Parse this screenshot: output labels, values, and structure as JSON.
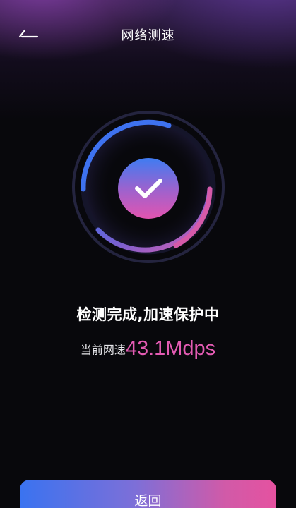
{
  "header": {
    "title": "网络测速",
    "back_icon": "back-arrow-icon"
  },
  "gauge": {
    "progress": 1,
    "status_icon": "check-icon",
    "colors": {
      "ring_start": "#3e72f0",
      "ring_end": "#e060b0",
      "badge_start": "#3f7cf2",
      "badge_end": "#e354b0"
    }
  },
  "result": {
    "status": "检测完成,加速保护中",
    "speed_label": "当前网速",
    "speed_value": "43.1Mdps"
  },
  "footer": {
    "return_label": "返回"
  }
}
